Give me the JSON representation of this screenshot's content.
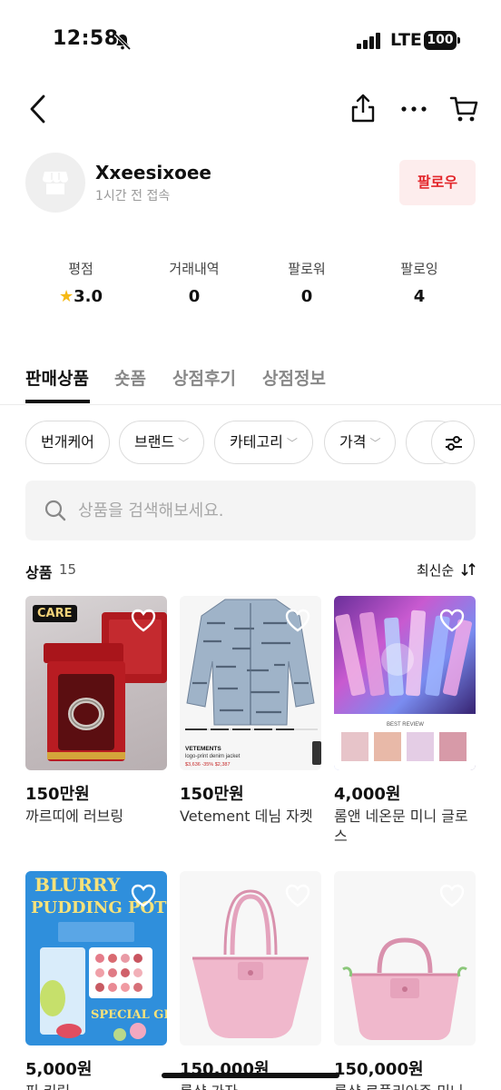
{
  "status_bar": {
    "time": "12:58",
    "network": "LTE",
    "battery": "100",
    "icons": [
      "bell-slash-icon",
      "signal-icon"
    ]
  },
  "nav": {
    "icons": [
      "back-icon",
      "share-icon",
      "more-icon",
      "cart-icon"
    ]
  },
  "shop": {
    "name": "Xxeesixoee",
    "last_seen": "1시간 전 접속",
    "follow_label": "팔로우",
    "avatar_icon": "store-icon"
  },
  "stats": [
    {
      "label": "평점",
      "value": "3.0",
      "icon": "star-icon"
    },
    {
      "label": "거래내역",
      "value": "0"
    },
    {
      "label": "팔로워",
      "value": "0"
    },
    {
      "label": "팔로잉",
      "value": "4"
    }
  ],
  "tabs": [
    {
      "label": "판매상품",
      "active": true
    },
    {
      "label": "숏폼",
      "active": false
    },
    {
      "label": "상점후기",
      "active": false
    },
    {
      "label": "상점정보",
      "active": false
    }
  ],
  "filters": {
    "chips": [
      "번개케어",
      "브랜드",
      "카테고리",
      "가격"
    ],
    "settings_icon": "sliders-icon"
  },
  "search": {
    "placeholder": "상품을 검색해보세요."
  },
  "list": {
    "title": "상품",
    "count": "15",
    "sort_label": "최신순"
  },
  "products": [
    {
      "price": "150만원",
      "name": "까르띠에 러브링",
      "badge": "CARE"
    },
    {
      "price": "150만원",
      "name": "Vetement 데님 자켓"
    },
    {
      "price": "4,000원",
      "name": "롬앤 네온문 미니 글로스"
    },
    {
      "price": "5,000원",
      "name": "핑 키링"
    },
    {
      "price": "150,000원",
      "name": "롱샴 가자"
    },
    {
      "price": "150,000원",
      "name": "롱샴 르플리아주 미니"
    }
  ],
  "image_text": {
    "jacket_brand": "VETEMENTS",
    "jacket_desc": "logo-print denim jacket",
    "jacket_price": "$3,636 -35% $2,387",
    "gloss_label": "BEST REVIEW",
    "pudding_title1": "BLURRY",
    "pudding_title2": "PUDDING POT",
    "pudding_footer": "SPECIAL GIFT"
  },
  "colors": {
    "follow_text": "#e3262b",
    "follow_bg": "#fdeded",
    "star": "#f6b915"
  }
}
